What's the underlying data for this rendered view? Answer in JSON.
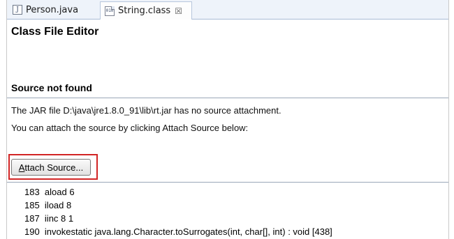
{
  "tabs": [
    {
      "label": "Person.java",
      "icon": "java-file-icon",
      "active": false
    },
    {
      "label": "String.class",
      "icon": "class-file-icon",
      "active": true,
      "close": "☒"
    }
  ],
  "editor": {
    "title": "Class File Editor",
    "section_title": "Source not found",
    "message_1": "The JAR file D:\\java\\jre1.8.0_91\\lib\\rt.jar has no source attachment.",
    "message_2": "You can attach the source by clicking Attach Source below:",
    "attach_button": {
      "mnemonic": "A",
      "rest": "ttach Source..."
    },
    "highlight_color": "#d22525"
  },
  "bytecode": [
    "183  aload 6",
    "185  iload 8",
    "187  iinc 8 1",
    "190  invokestatic java.lang.Character.toSurrogates(int, char[], int) : void [438]"
  ]
}
